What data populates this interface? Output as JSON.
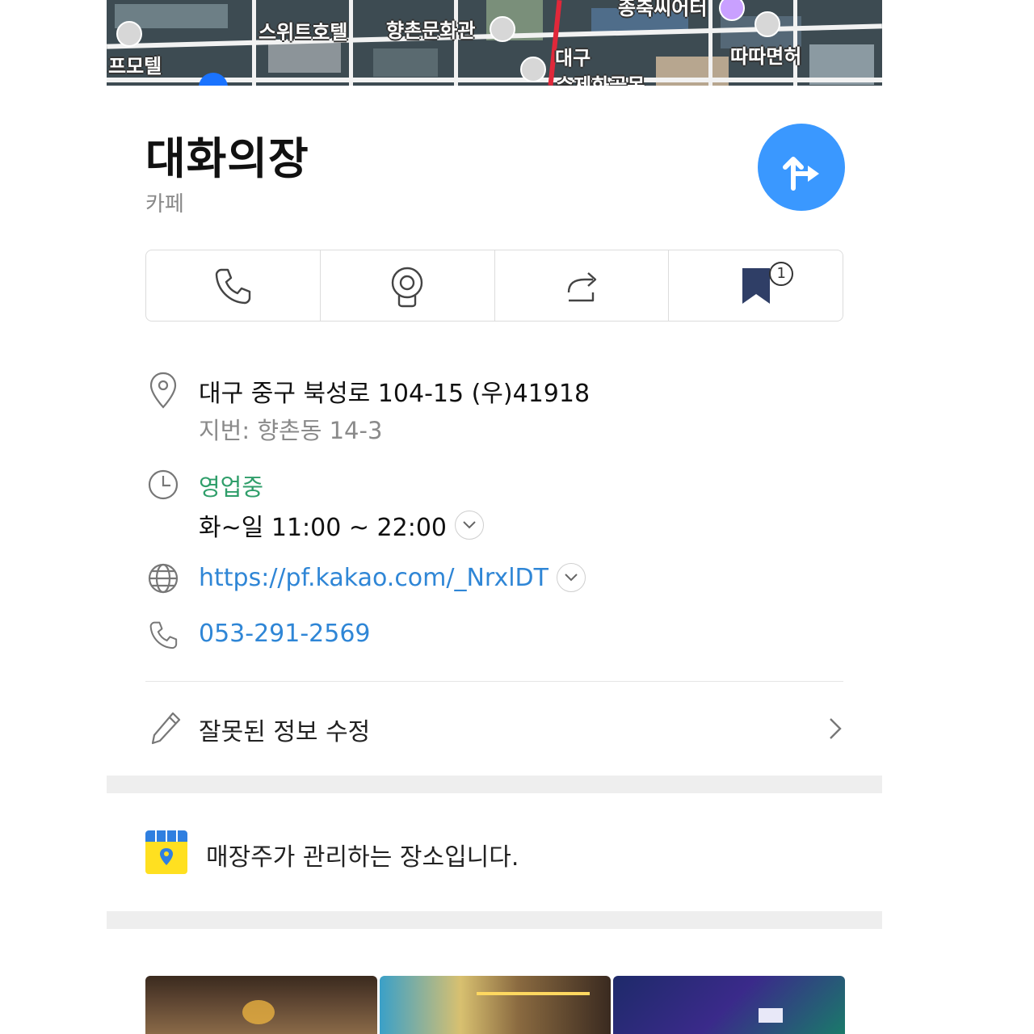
{
  "map": {
    "labels": [
      "프모텔",
      "스위트호텔",
      "향촌문화관",
      "대구",
      "수제화골목",
      "종축씨어터",
      "따따면허"
    ]
  },
  "place": {
    "name": "대화의장",
    "category": "카페"
  },
  "actions": {
    "bookmark_count": "1"
  },
  "info": {
    "address": "대구 중구 북성로 104-15 (우)41918",
    "jibun": "지번: 향촌동 14-3",
    "status": "영업중",
    "hours": "화~일 11:00 ~ 22:00",
    "website": "https://pf.kakao.com/_NrxlDT",
    "phone": "053-291-2569"
  },
  "edit": {
    "label": "잘못된 정보 수정"
  },
  "owner": {
    "label": "매장주가 관리하는 장소입니다."
  },
  "colors": {
    "accent": "#3a98ff",
    "link": "#2f86d6",
    "open_status": "#2f9e6a",
    "shop_yellow": "#ffe020"
  }
}
